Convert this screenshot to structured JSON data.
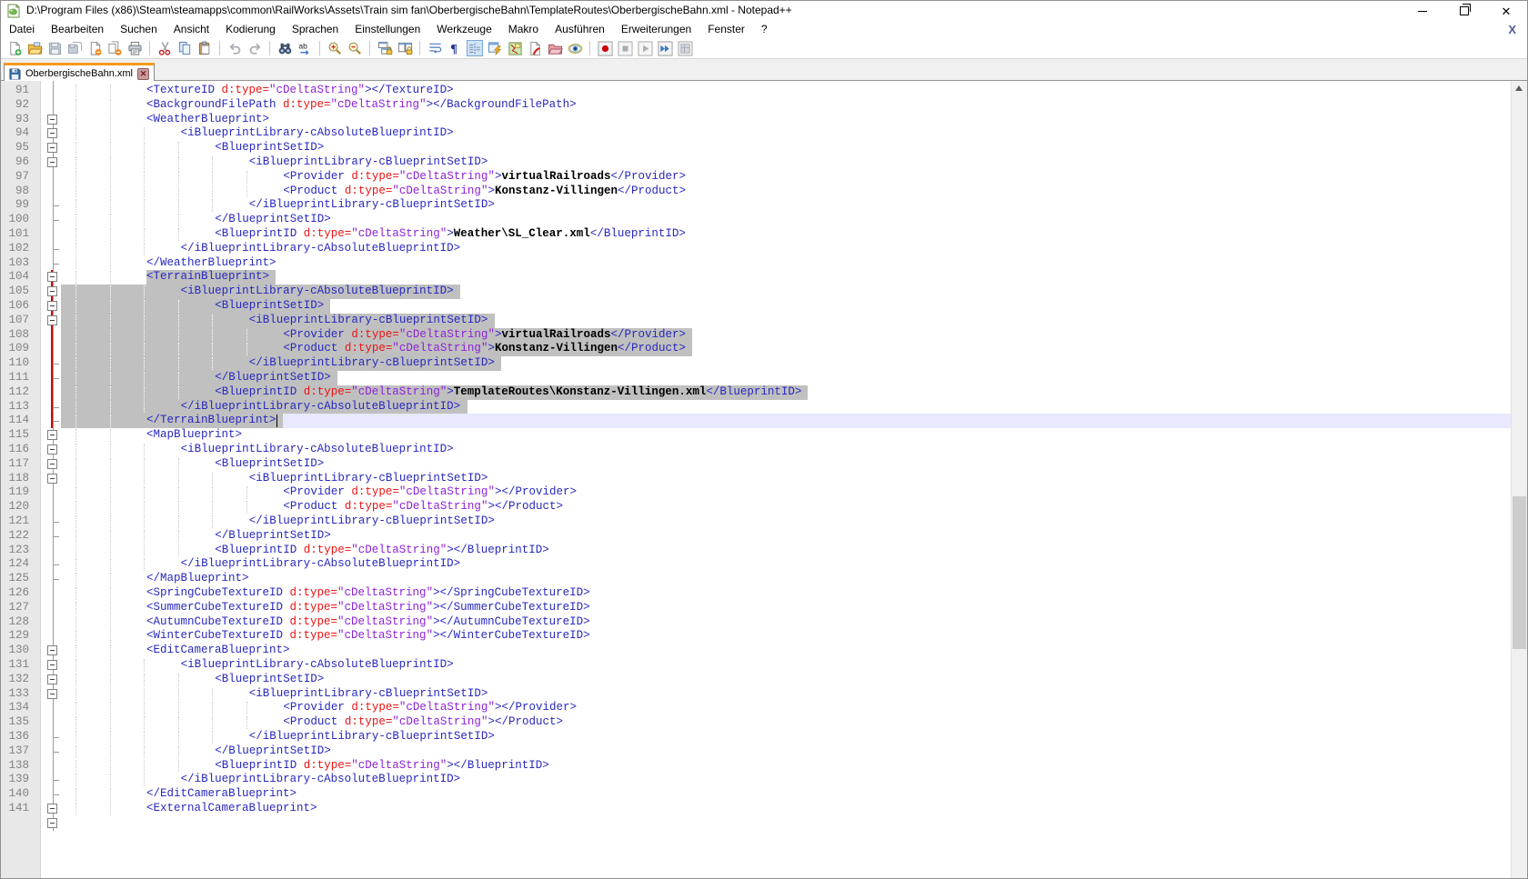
{
  "window": {
    "title": "D:\\Program Files (x86)\\Steam\\steamapps\\common\\RailWorks\\Assets\\Train sim fan\\OberbergischeBahn\\TemplateRoutes\\OberbergischeBahn.xml - Notepad++",
    "controls": {
      "minimize": "minimize",
      "restore": "restore",
      "close": "close"
    }
  },
  "menu": {
    "items": [
      "Datei",
      "Bearbeiten",
      "Suchen",
      "Ansicht",
      "Kodierung",
      "Sprachen",
      "Einstellungen",
      "Werkzeuge",
      "Makro",
      "Ausführen",
      "Erweiterungen",
      "Fenster",
      "?"
    ],
    "close_doc_label": "X"
  },
  "toolbar": {
    "items": [
      {
        "name": "new-file"
      },
      {
        "name": "open-folder"
      },
      {
        "name": "save",
        "disabled": true
      },
      {
        "name": "save-all",
        "disabled": true
      },
      {
        "name": "close-doc"
      },
      {
        "name": "close-all-docs"
      },
      {
        "name": "print"
      },
      {
        "name": "sep"
      },
      {
        "name": "cut"
      },
      {
        "name": "copy"
      },
      {
        "name": "paste"
      },
      {
        "name": "sep"
      },
      {
        "name": "undo",
        "disabled": true
      },
      {
        "name": "redo",
        "disabled": true
      },
      {
        "name": "sep"
      },
      {
        "name": "find"
      },
      {
        "name": "replace"
      },
      {
        "name": "sep"
      },
      {
        "name": "zoom-in"
      },
      {
        "name": "zoom-out"
      },
      {
        "name": "sep"
      },
      {
        "name": "sync-vertical"
      },
      {
        "name": "sync-horizontal"
      },
      {
        "name": "sep"
      },
      {
        "name": "word-wrap"
      },
      {
        "name": "show-all-characters"
      },
      {
        "name": "indent-guide",
        "active": true
      },
      {
        "name": "function-list"
      },
      {
        "name": "document-map"
      },
      {
        "name": "function-panel"
      },
      {
        "name": "folder-as-workspace"
      },
      {
        "name": "document-monitor"
      },
      {
        "name": "sep"
      },
      {
        "name": "macro-record"
      },
      {
        "name": "macro-stop",
        "disabled": true
      },
      {
        "name": "macro-play",
        "disabled": true
      },
      {
        "name": "macro-run-multiple"
      },
      {
        "name": "macro-save",
        "disabled": true
      }
    ]
  },
  "tabs": [
    {
      "label": "OberbergischeBahn.xml",
      "active": true,
      "saved": true,
      "close_label": "x"
    }
  ],
  "colors": {
    "tag": "#2828be",
    "attribute": "#eb1414",
    "string": "#8d22d8",
    "text_value": "#000000",
    "selection": "#c0c0c0",
    "current_line": "#e8e8ff",
    "change_marker": "#d40000",
    "tab_accent": "#f89a1c",
    "line_number": "#828282"
  },
  "editor": {
    "first_visible_line": 91,
    "last_visible_line": 141,
    "selection_lines": {
      "from": 104,
      "to": 114
    },
    "current_line": 114,
    "changed_lines": {
      "from": 104,
      "to": 114
    },
    "lines": [
      {
        "n": 91,
        "l": 0,
        "f": "",
        "s": "",
        "k": [
          [
            "t",
            "<TextureID "
          ],
          [
            "a",
            "d:type="
          ],
          [
            "s",
            "\"cDeltaString\""
          ],
          [
            "t",
            "></TextureID>"
          ]
        ]
      },
      {
        "n": 92,
        "l": 0,
        "f": "",
        "s": "",
        "k": [
          [
            "t",
            "<BackgroundFilePath "
          ],
          [
            "a",
            "d:type="
          ],
          [
            "s",
            "\"cDeltaString\""
          ],
          [
            "t",
            "></BackgroundFilePath>"
          ]
        ]
      },
      {
        "n": 93,
        "l": 0,
        "f": "box",
        "s": "",
        "k": [
          [
            "t",
            "<WeatherBlueprint>"
          ]
        ]
      },
      {
        "n": 94,
        "l": 1,
        "f": "box",
        "s": "",
        "k": [
          [
            "t",
            "<iBlueprintLibrary-cAbsoluteBlueprintID>"
          ]
        ]
      },
      {
        "n": 95,
        "l": 2,
        "f": "box",
        "s": "",
        "k": [
          [
            "t",
            "<BlueprintSetID>"
          ]
        ]
      },
      {
        "n": 96,
        "l": 3,
        "f": "box",
        "s": "",
        "k": [
          [
            "t",
            "<iBlueprintLibrary-cBlueprintSetID>"
          ]
        ]
      },
      {
        "n": 97,
        "l": 4,
        "f": "",
        "s": "",
        "k": [
          [
            "t",
            "<Provider "
          ],
          [
            "a",
            "d:type="
          ],
          [
            "s",
            "\"cDeltaString\""
          ],
          [
            "t",
            ">"
          ],
          [
            "x",
            "virtualRailroads"
          ],
          [
            "t",
            "</Provider>"
          ]
        ]
      },
      {
        "n": 98,
        "l": 4,
        "f": "",
        "s": "",
        "k": [
          [
            "t",
            "<Product "
          ],
          [
            "a",
            "d:type="
          ],
          [
            "s",
            "\"cDeltaString\""
          ],
          [
            "t",
            ">"
          ],
          [
            "x",
            "Konstanz-Villingen"
          ],
          [
            "t",
            "</Product>"
          ]
        ]
      },
      {
        "n": 99,
        "l": 3,
        "f": "tick",
        "s": "",
        "k": [
          [
            "t",
            "</iBlueprintLibrary-cBlueprintSetID>"
          ]
        ]
      },
      {
        "n": 100,
        "l": 2,
        "f": "tick",
        "s": "",
        "k": [
          [
            "t",
            "</BlueprintSetID>"
          ]
        ]
      },
      {
        "n": 101,
        "l": 2,
        "f": "",
        "s": "",
        "k": [
          [
            "t",
            "<BlueprintID "
          ],
          [
            "a",
            "d:type="
          ],
          [
            "s",
            "\"cDeltaString\""
          ],
          [
            "t",
            ">"
          ],
          [
            "x",
            "Weather\\SL_Clear.xml"
          ],
          [
            "t",
            "</BlueprintID>"
          ]
        ]
      },
      {
        "n": 102,
        "l": 1,
        "f": "tick",
        "s": "",
        "k": [
          [
            "t",
            "</iBlueprintLibrary-cAbsoluteBlueprintID>"
          ]
        ]
      },
      {
        "n": 103,
        "l": 0,
        "f": "tick",
        "s": "",
        "k": [
          [
            "t",
            "</WeatherBlueprint>"
          ]
        ]
      },
      {
        "n": 104,
        "l": 0,
        "f": "box",
        "s": "text",
        "k": [
          [
            "t",
            "<TerrainBlueprint>"
          ]
        ]
      },
      {
        "n": 105,
        "l": 1,
        "f": "box",
        "s": "line",
        "k": [
          [
            "t",
            "<iBlueprintLibrary-cAbsoluteBlueprintID>"
          ]
        ]
      },
      {
        "n": 106,
        "l": 2,
        "f": "box",
        "s": "line",
        "k": [
          [
            "t",
            "<BlueprintSetID>"
          ]
        ]
      },
      {
        "n": 107,
        "l": 3,
        "f": "box",
        "s": "line",
        "k": [
          [
            "t",
            "<iBlueprintLibrary-cBlueprintSetID>"
          ]
        ]
      },
      {
        "n": 108,
        "l": 4,
        "f": "",
        "s": "line",
        "k": [
          [
            "t",
            "<Provider "
          ],
          [
            "a",
            "d:type="
          ],
          [
            "s",
            "\"cDeltaString\""
          ],
          [
            "t",
            ">"
          ],
          [
            "x",
            "virtualRailroads"
          ],
          [
            "t",
            "</Provider>"
          ]
        ]
      },
      {
        "n": 109,
        "l": 4,
        "f": "",
        "s": "line",
        "k": [
          [
            "t",
            "<Product "
          ],
          [
            "a",
            "d:type="
          ],
          [
            "s",
            "\"cDeltaString\""
          ],
          [
            "t",
            ">"
          ],
          [
            "x",
            "Konstanz-Villingen"
          ],
          [
            "t",
            "</Product>"
          ]
        ]
      },
      {
        "n": 110,
        "l": 3,
        "f": "tick",
        "s": "line",
        "k": [
          [
            "t",
            "</iBlueprintLibrary-cBlueprintSetID>"
          ]
        ]
      },
      {
        "n": 111,
        "l": 2,
        "f": "tick",
        "s": "line",
        "k": [
          [
            "t",
            "</BlueprintSetID>"
          ]
        ]
      },
      {
        "n": 112,
        "l": 2,
        "f": "",
        "s": "line",
        "k": [
          [
            "t",
            "<BlueprintID "
          ],
          [
            "a",
            "d:type="
          ],
          [
            "s",
            "\"cDeltaString\""
          ],
          [
            "t",
            ">"
          ],
          [
            "x",
            "TemplateRoutes\\Konstanz-Villingen.xml"
          ],
          [
            "t",
            "</BlueprintID>"
          ]
        ]
      },
      {
        "n": 113,
        "l": 1,
        "f": "tick",
        "s": "line",
        "k": [
          [
            "t",
            "</iBlueprintLibrary-cAbsoluteBlueprintID>"
          ]
        ]
      },
      {
        "n": 114,
        "l": 0,
        "f": "tick",
        "s": "line",
        "cur": true,
        "caret": true,
        "k": [
          [
            "t",
            "</TerrainBlueprint>"
          ]
        ]
      },
      {
        "n": 115,
        "l": 0,
        "f": "box",
        "s": "",
        "k": [
          [
            "t",
            "<MapBlueprint>"
          ]
        ]
      },
      {
        "n": 116,
        "l": 1,
        "f": "box",
        "s": "",
        "k": [
          [
            "t",
            "<iBlueprintLibrary-cAbsoluteBlueprintID>"
          ]
        ]
      },
      {
        "n": 117,
        "l": 2,
        "f": "box",
        "s": "",
        "k": [
          [
            "t",
            "<BlueprintSetID>"
          ]
        ]
      },
      {
        "n": 118,
        "l": 3,
        "f": "box",
        "s": "",
        "k": [
          [
            "t",
            "<iBlueprintLibrary-cBlueprintSetID>"
          ]
        ]
      },
      {
        "n": 119,
        "l": 4,
        "f": "",
        "s": "",
        "k": [
          [
            "t",
            "<Provider "
          ],
          [
            "a",
            "d:type="
          ],
          [
            "s",
            "\"cDeltaString\""
          ],
          [
            "t",
            "></Provider>"
          ]
        ]
      },
      {
        "n": 120,
        "l": 4,
        "f": "",
        "s": "",
        "k": [
          [
            "t",
            "<Product "
          ],
          [
            "a",
            "d:type="
          ],
          [
            "s",
            "\"cDeltaString\""
          ],
          [
            "t",
            "></Product>"
          ]
        ]
      },
      {
        "n": 121,
        "l": 3,
        "f": "tick",
        "s": "",
        "k": [
          [
            "t",
            "</iBlueprintLibrary-cBlueprintSetID>"
          ]
        ]
      },
      {
        "n": 122,
        "l": 2,
        "f": "tick",
        "s": "",
        "k": [
          [
            "t",
            "</BlueprintSetID>"
          ]
        ]
      },
      {
        "n": 123,
        "l": 2,
        "f": "",
        "s": "",
        "k": [
          [
            "t",
            "<BlueprintID "
          ],
          [
            "a",
            "d:type="
          ],
          [
            "s",
            "\"cDeltaString\""
          ],
          [
            "t",
            "></BlueprintID>"
          ]
        ]
      },
      {
        "n": 124,
        "l": 1,
        "f": "tick",
        "s": "",
        "k": [
          [
            "t",
            "</iBlueprintLibrary-cAbsoluteBlueprintID>"
          ]
        ]
      },
      {
        "n": 125,
        "l": 0,
        "f": "tick",
        "s": "",
        "k": [
          [
            "t",
            "</MapBlueprint>"
          ]
        ]
      },
      {
        "n": 126,
        "l": 0,
        "f": "",
        "s": "",
        "k": [
          [
            "t",
            "<SpringCubeTextureID "
          ],
          [
            "a",
            "d:type="
          ],
          [
            "s",
            "\"cDeltaString\""
          ],
          [
            "t",
            "></SpringCubeTextureID>"
          ]
        ]
      },
      {
        "n": 127,
        "l": 0,
        "f": "",
        "s": "",
        "k": [
          [
            "t",
            "<SummerCubeTextureID "
          ],
          [
            "a",
            "d:type="
          ],
          [
            "s",
            "\"cDeltaString\""
          ],
          [
            "t",
            "></SummerCubeTextureID>"
          ]
        ]
      },
      {
        "n": 128,
        "l": 0,
        "f": "",
        "s": "",
        "k": [
          [
            "t",
            "<AutumnCubeTextureID "
          ],
          [
            "a",
            "d:type="
          ],
          [
            "s",
            "\"cDeltaString\""
          ],
          [
            "t",
            "></AutumnCubeTextureID>"
          ]
        ]
      },
      {
        "n": 129,
        "l": 0,
        "f": "",
        "s": "",
        "k": [
          [
            "t",
            "<WinterCubeTextureID "
          ],
          [
            "a",
            "d:type="
          ],
          [
            "s",
            "\"cDeltaString\""
          ],
          [
            "t",
            "></WinterCubeTextureID>"
          ]
        ]
      },
      {
        "n": 130,
        "l": 0,
        "f": "box",
        "s": "",
        "k": [
          [
            "t",
            "<EditCameraBlueprint>"
          ]
        ]
      },
      {
        "n": 131,
        "l": 1,
        "f": "box",
        "s": "",
        "k": [
          [
            "t",
            "<iBlueprintLibrary-cAbsoluteBlueprintID>"
          ]
        ]
      },
      {
        "n": 132,
        "l": 2,
        "f": "box",
        "s": "",
        "k": [
          [
            "t",
            "<BlueprintSetID>"
          ]
        ]
      },
      {
        "n": 133,
        "l": 3,
        "f": "box",
        "s": "",
        "k": [
          [
            "t",
            "<iBlueprintLibrary-cBlueprintSetID>"
          ]
        ]
      },
      {
        "n": 134,
        "l": 4,
        "f": "",
        "s": "",
        "k": [
          [
            "t",
            "<Provider "
          ],
          [
            "a",
            "d:type="
          ],
          [
            "s",
            "\"cDeltaString\""
          ],
          [
            "t",
            "></Provider>"
          ]
        ]
      },
      {
        "n": 135,
        "l": 4,
        "f": "",
        "s": "",
        "k": [
          [
            "t",
            "<Product "
          ],
          [
            "a",
            "d:type="
          ],
          [
            "s",
            "\"cDeltaString\""
          ],
          [
            "t",
            "></Product>"
          ]
        ]
      },
      {
        "n": 136,
        "l": 3,
        "f": "tick",
        "s": "",
        "k": [
          [
            "t",
            "</iBlueprintLibrary-cBlueprintSetID>"
          ]
        ]
      },
      {
        "n": 137,
        "l": 2,
        "f": "tick",
        "s": "",
        "k": [
          [
            "t",
            "</BlueprintSetID>"
          ]
        ]
      },
      {
        "n": 138,
        "l": 2,
        "f": "",
        "s": "",
        "k": [
          [
            "t",
            "<BlueprintID "
          ],
          [
            "a",
            "d:type="
          ],
          [
            "s",
            "\"cDeltaString\""
          ],
          [
            "t",
            "></BlueprintID>"
          ]
        ]
      },
      {
        "n": 139,
        "l": 1,
        "f": "tick",
        "s": "",
        "k": [
          [
            "t",
            "</iBlueprintLibrary-cAbsoluteBlueprintID>"
          ]
        ]
      },
      {
        "n": 140,
        "l": 0,
        "f": "tick",
        "s": "",
        "k": [
          [
            "t",
            "</EditCameraBlueprint>"
          ]
        ]
      },
      {
        "n": 141,
        "l": 0,
        "f": "box",
        "s": "",
        "k": [
          [
            "t",
            "<ExternalCameraBlueprint>"
          ]
        ]
      }
    ]
  }
}
